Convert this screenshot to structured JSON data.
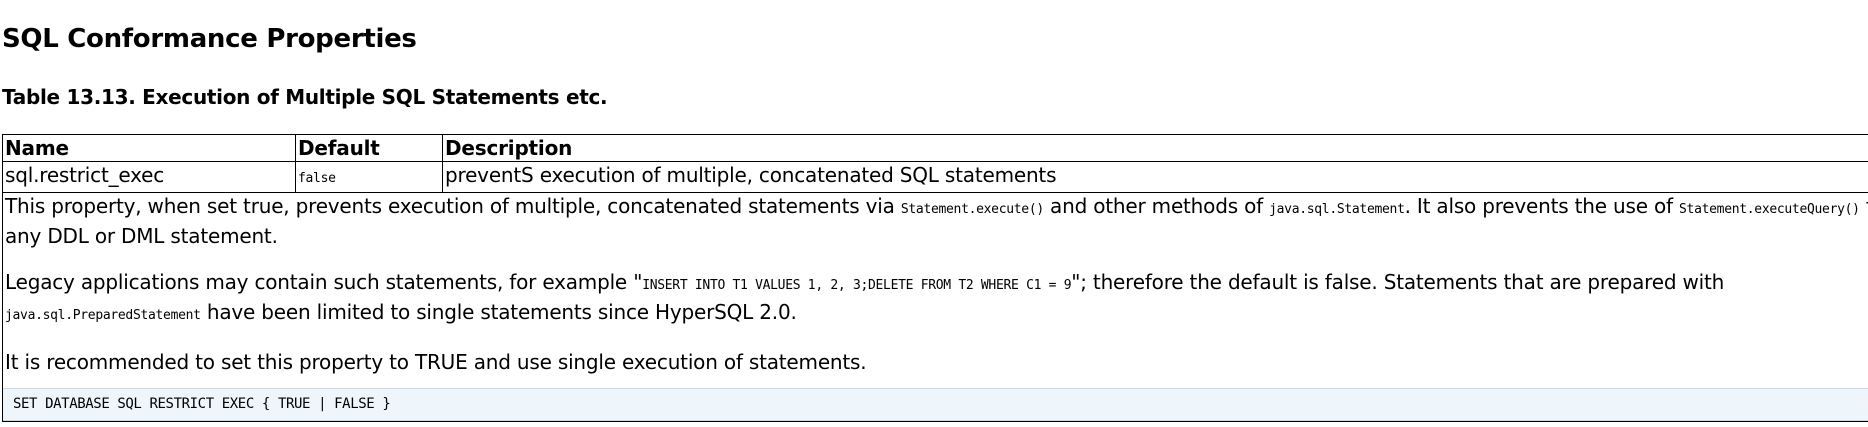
{
  "section": {
    "title": "SQL Conformance Properties"
  },
  "table": {
    "caption": "Table 13.13. Execution of Multiple SQL Statements etc.",
    "headers": {
      "name": "Name",
      "default": "Default",
      "description": "Description"
    },
    "row": {
      "name": "sql.restrict_exec",
      "default": "false",
      "description": "preventS execution of multiple, concatenated SQL statements"
    },
    "details": {
      "p1": {
        "t1": "This property, when set true, prevents execution of multiple, concatenated statements via ",
        "c1": "Statement.execute()",
        "t2": " and other methods of ",
        "c2": "java.sql.Statement",
        "t3": ". It also prevents the use of ",
        "c3": "Statement.executeQuery()",
        "t4": " for any DDL or DML statement."
      },
      "p2": {
        "t1": "Legacy applications may contain such statements, for example \"",
        "c1": "INSERT INTO T1 VALUES 1, 2, 3;DELETE FROM T2 WHERE C1 = 9",
        "t2": "\"; therefore the default is false. Statements that are prepared with ",
        "c2": "java.sql.PreparedStatement",
        "t3": " have been limited to single statements since HyperSQL 2.0."
      },
      "p3": "It is recommended to set this property to TRUE and use single execution of statements.",
      "code": "SET DATABASE SQL RESTRICT EXEC { TRUE | FALSE }"
    }
  }
}
